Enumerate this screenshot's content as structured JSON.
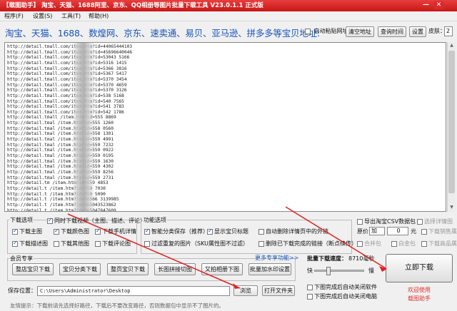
{
  "window": {
    "title": "【载图助手】 淘宝、天猫、1688阿里、京东、QQ相册等图片批量下载工具 V23.0.1.1 正式版",
    "minimize": "—",
    "close": "✕"
  },
  "menu": [
    "程序(F)",
    "设置(S)",
    "工具(T)",
    "帮助(H)"
  ],
  "urlbar": {
    "label": "淘宝、天猫、1688、数煌网、京东、速卖通、易贝、亚马逊、拼多多等宝贝地址:",
    "auto_paste": "自动粘贴网址",
    "clear_btn": "清空地址",
    "query_btn": "查询时间",
    "settings_btn": "设置",
    "skin_label": "皮肤：",
    "skin_value": "2"
  },
  "urls": [
    "http://detail.tmall.com/item.htm?id=44065444103",
    "http://detail.tmall.com/item.htm?id=45696640046",
    "http://detail.tmall.com/item.htm?id=53043     5166",
    "http://detail.tmall.com/item.htm?id=5316      1415",
    "http://detail.tmall.com/item.htm?id=5366      3816",
    "http://detail.tmall.com/item.htm?id=5367      5417",
    "http://detail.tmall.com/item.htm?id=5370      3454",
    "http://detail.tmall.com/item.htm?id=5370      4659",
    "http://detail.tmall.com/item.htm?id=5370      3126",
    "http://detail.tmall.com/item.htm?id=538       5168",
    "http://detail.tmall.com/item.htm?id=540       7565",
    "http://detail.tmall.com/item.htm?id=541       3783",
    "http://detail.tmall.com/item.htm?id=542       1786",
    "http://detail.tmall       /item.htm?id=555    8869",
    "http://detail.tmal        /item.htm?id=555    1260",
    "http://detail.tmal        /item.htm?id=558    0560",
    "http://detail.tmal        /item.htm?id=558    1301",
    "http://detail.tmal        /item.htm?id=559    4991",
    "http://detail.tmal        /item.htm?id=559    7232",
    "http://detail.tmal        /item.htm?id=559    0922",
    "http://detail.tmal        /item.htm?id=559    0195",
    "http://detail.tmal        /item.htm?id=559    1630",
    "http://detail.tmal        /item.htm?id=559    4302",
    "http://detail.tmal        /item.htm?id=559    8256",
    "http://detail.tmal        /item.htm?id=559    2731",
    "http://detail.tm          /item.htm?id=559    4853",
    "http://detail.t           /item.htm?id=559    7030",
    "http://detail.t           /item.htm?id=559    5090",
    "http://detail.t           /item.htm?id=56566  3139985",
    "http://detail.t           /item.htm?id=565043523862",
    "http://detail.t           /item.htm?id=565047847609"
  ],
  "download_options": {
    "title": "下载选项",
    "items": [
      {
        "label": "同时下载视频（主图、描述、评论）",
        "checked": true
      },
      {
        "label": "下载主图",
        "checked": true
      },
      {
        "label": "下载颜色图",
        "checked": true
      },
      {
        "label": "下载手机详情",
        "checked": true
      },
      {
        "label": "下载描述图",
        "checked": true
      },
      {
        "label": "下载其他图",
        "checked": false
      },
      {
        "label": "下载评论图",
        "checked": false
      }
    ]
  },
  "function_options": {
    "title": "功能选项",
    "items": [
      {
        "label": "智能分类保存（推荐）",
        "checked": true
      },
      {
        "label": "显示宝贝标题",
        "checked": true
      },
      {
        "label": "自动删除详情页中的外链",
        "checked": false
      },
      {
        "label": "过滤重复的图片（SKU属性图不过滤）",
        "checked": false
      },
      {
        "label": "删除已下载完成的链接（断点续传）",
        "checked": false
      }
    ]
  },
  "csv": {
    "export": "导出淘宝CSV数据包",
    "select_details": "选择详情图",
    "price_label": "原价",
    "op_value": "加",
    "amount_value": "0",
    "unit": "元",
    "main_attr": "下载销售属性",
    "fold_package": "合并包",
    "pkg_label": "白金包",
    "sale_attr": "下载商品属性"
  },
  "member": {
    "title": "会员专享",
    "more": "更多专享功能>>",
    "buttons": [
      "整店宝贝下载",
      "宝贝分类下载",
      "整页宝贝下载",
      "长图拼接切图",
      "又拍相册下图",
      "批量加水印设置"
    ]
  },
  "speed": {
    "label": "批量下载速度：",
    "value": "8710毫秒",
    "fast": "快",
    "slow": "慢"
  },
  "after": {
    "close_software": "下图完成后自动关闭软件",
    "shutdown": "下图完成后自动关闭电脑"
  },
  "start_btn": "立即下载",
  "welcome": [
    "欢迎使用",
    "载图助手"
  ],
  "save": {
    "label": "保存位置：",
    "path": "C:\\Users\\Administrator\\Desktop",
    "browse": "浏览",
    "open_folder": "打开文件夹"
  },
  "tip": "友情提示：下载前请先选择好路径，下载后不要改变路径，否则数据包中显示不了图片的。"
}
